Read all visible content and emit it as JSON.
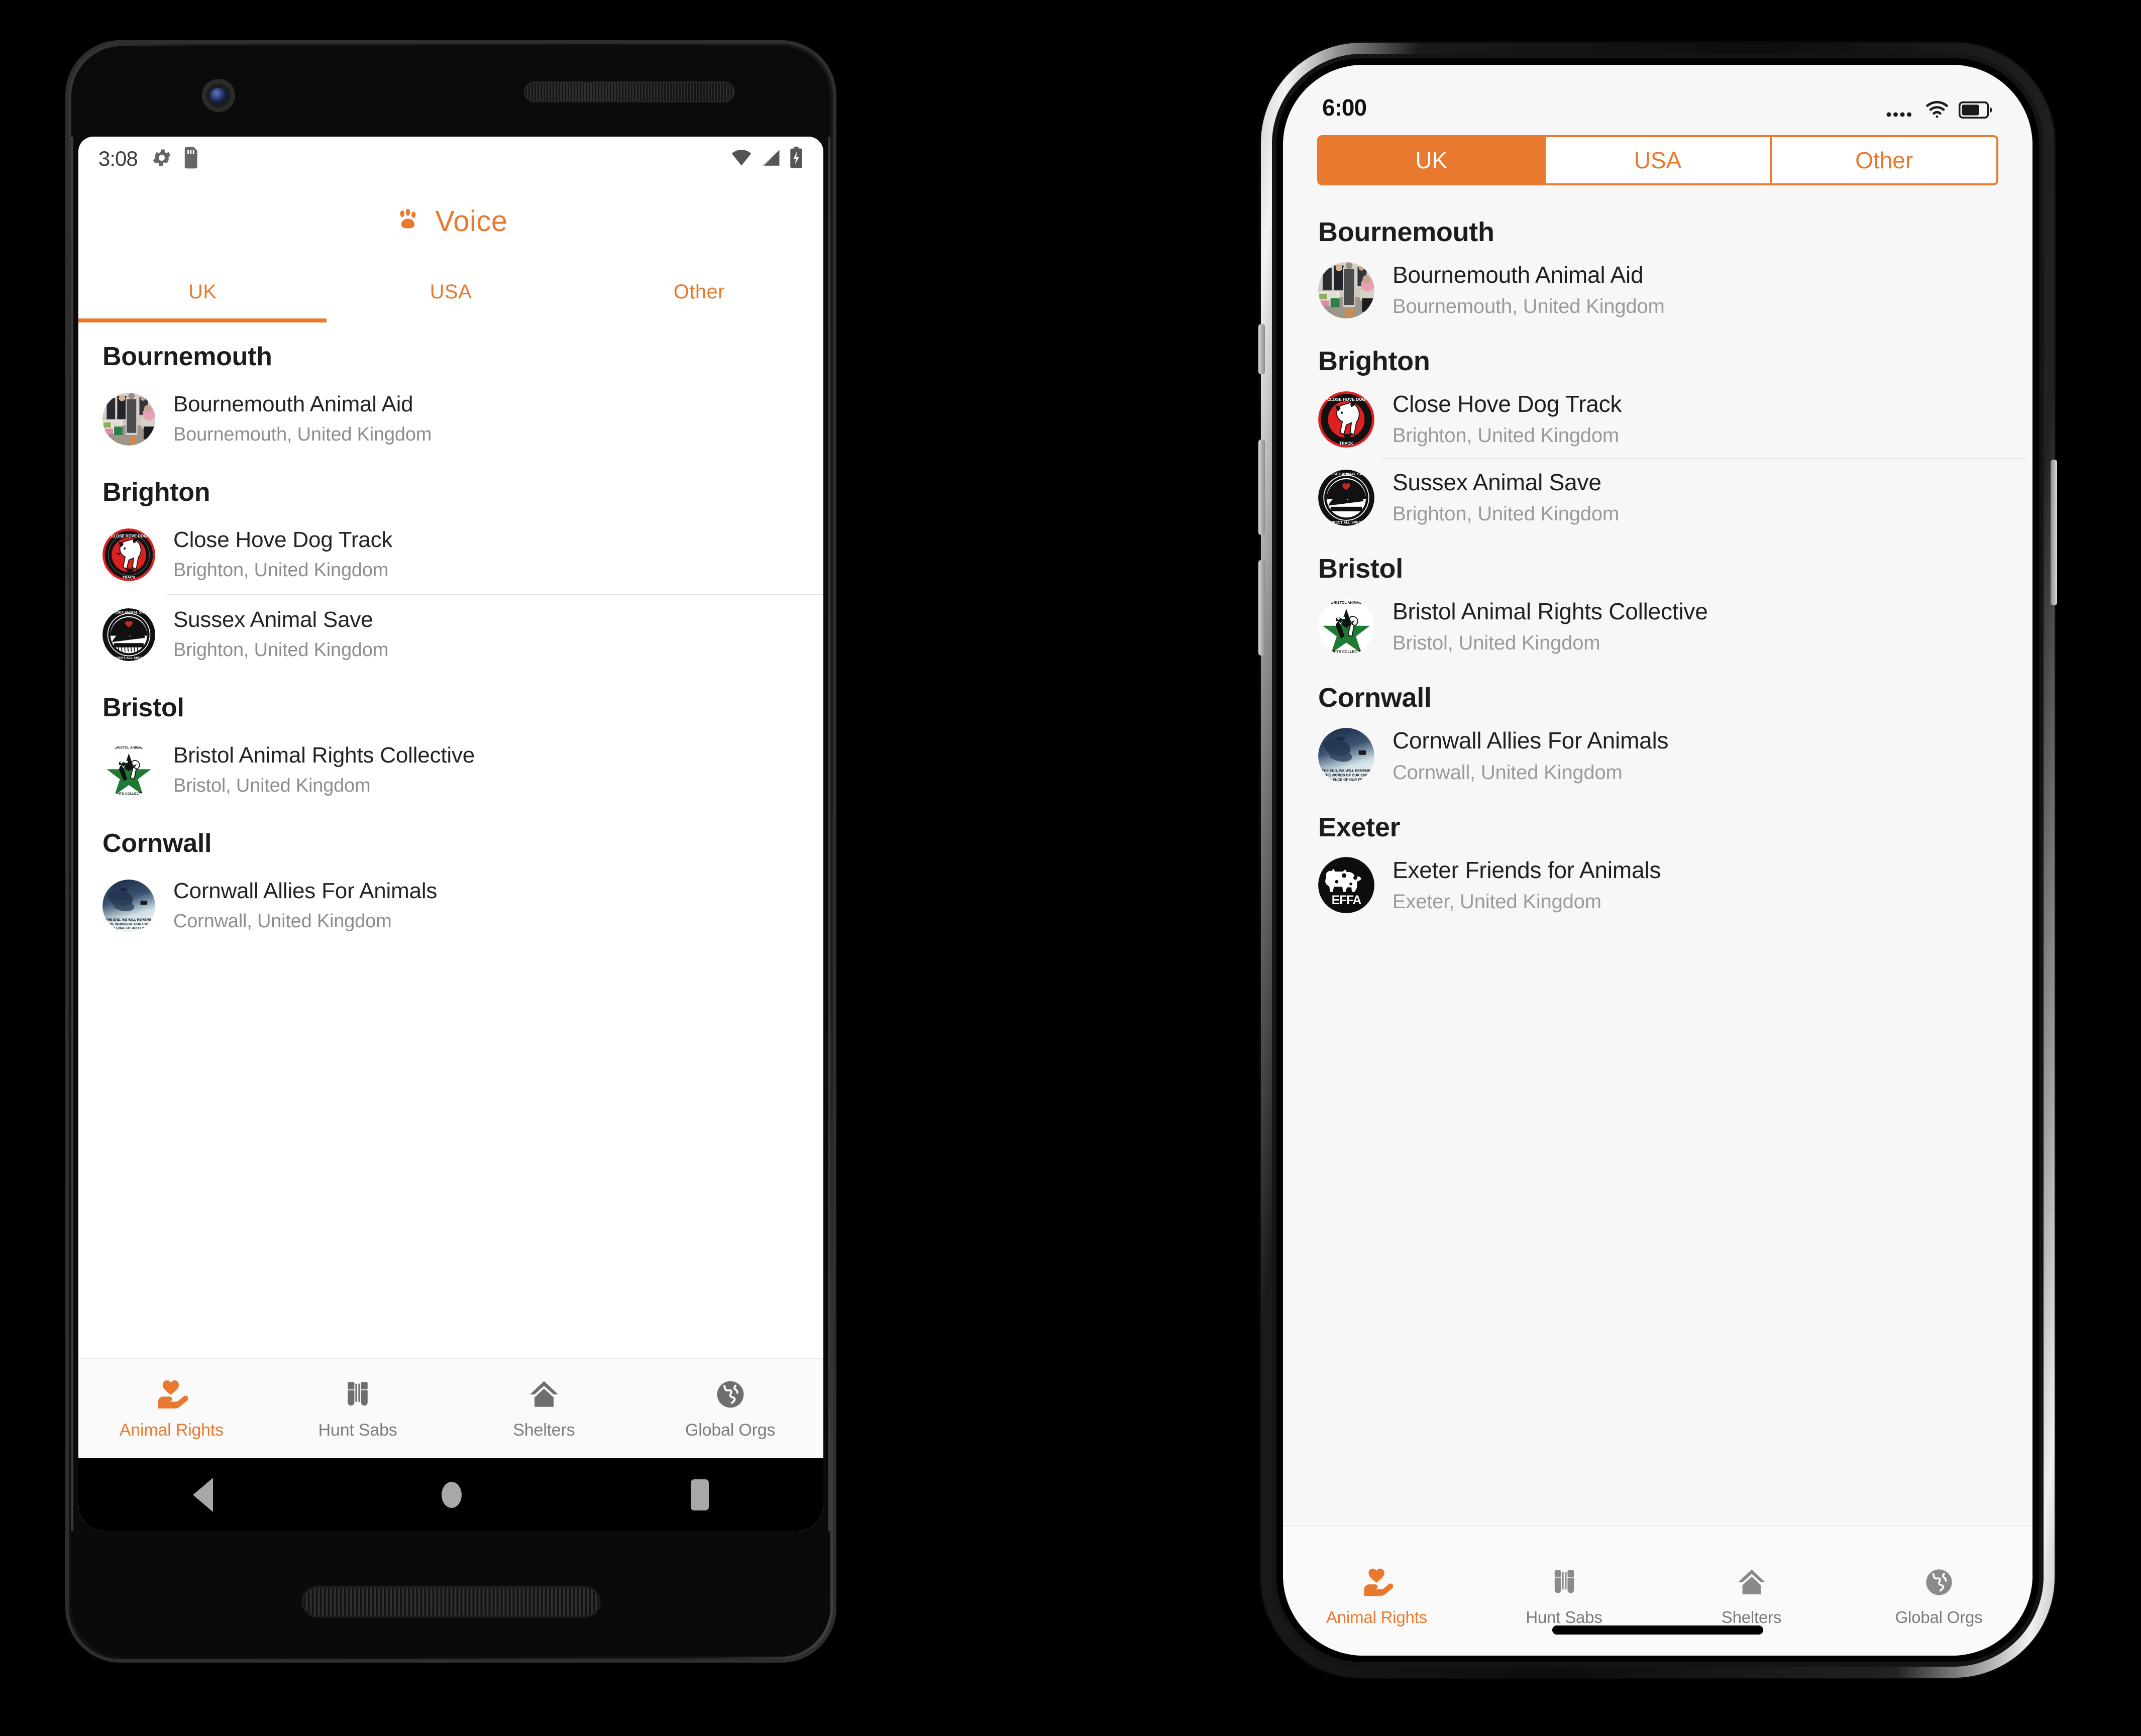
{
  "theme": {
    "accent": "#E8792E",
    "title_color": "#1c1c1c",
    "subtitle_color": "#8d8d8d"
  },
  "android": {
    "status_bar": {
      "time": "3:08",
      "icons": [
        "gear-icon",
        "sd-card-icon",
        "wifi-icon",
        "signal-icon",
        "battery-charging-icon"
      ]
    },
    "app_bar": {
      "title": "Voice",
      "logo": "paw-print-icon"
    },
    "tabs": [
      {
        "label": "UK",
        "active": true
      },
      {
        "label": "USA",
        "active": false
      },
      {
        "label": "Other",
        "active": false
      }
    ],
    "groups": [
      {
        "header": "Bournemouth",
        "items": [
          {
            "title": "Bournemouth Animal Aid",
            "subtitle": "Bournemouth, United Kingdom",
            "avatar": "bournemouth-stall-photo",
            "divider": false
          }
        ]
      },
      {
        "header": "Brighton",
        "items": [
          {
            "title": "Close Hove Dog Track",
            "subtitle": "Brighton, United Kingdom",
            "avatar": "close-hove-dog-track-logo",
            "divider": true
          },
          {
            "title": "Sussex Animal Save",
            "subtitle": "Brighton, United Kingdom",
            "avatar": "sussex-animal-save-logo",
            "divider": false
          }
        ]
      },
      {
        "header": "Bristol",
        "items": [
          {
            "title": "Bristol Animal Rights Collective",
            "subtitle": "Bristol, United Kingdom",
            "avatar": "bristol-animal-rights-collective-logo",
            "divider": false
          }
        ]
      },
      {
        "header": "Cornwall",
        "items": [
          {
            "title": "Cornwall Allies For Animals",
            "subtitle": "Cornwall, United Kingdom",
            "avatar": "cornwall-dolphin-photo",
            "divider": false
          }
        ]
      }
    ],
    "bottom_nav": [
      {
        "label": "Animal Rights",
        "icon": "heart-in-hand-icon",
        "active": true
      },
      {
        "label": "Hunt Sabs",
        "icon": "binoculars-icon",
        "active": false
      },
      {
        "label": "Shelters",
        "icon": "house-icon",
        "active": false
      },
      {
        "label": "Global Orgs",
        "icon": "globe-icon",
        "active": false
      }
    ],
    "system_nav": [
      "back-button",
      "home-button",
      "recents-button"
    ]
  },
  "iphone": {
    "status_bar": {
      "time": "6:00",
      "icons": [
        "cellular-dots-icon",
        "wifi-icon",
        "battery-icon"
      ]
    },
    "segmented_control": [
      {
        "label": "UK",
        "active": true
      },
      {
        "label": "USA",
        "active": false
      },
      {
        "label": "Other",
        "active": false
      }
    ],
    "groups": [
      {
        "header": "Bournemouth",
        "items": [
          {
            "title": "Bournemouth Animal Aid",
            "subtitle": "Bournemouth, United Kingdom",
            "avatar": "bournemouth-stall-photo",
            "divider": false
          }
        ]
      },
      {
        "header": "Brighton",
        "items": [
          {
            "title": "Close Hove Dog Track",
            "subtitle": "Brighton, United Kingdom",
            "avatar": "close-hove-dog-track-logo",
            "divider": true
          },
          {
            "title": "Sussex Animal Save",
            "subtitle": "Brighton, United Kingdom",
            "avatar": "sussex-animal-save-logo",
            "divider": false
          }
        ]
      },
      {
        "header": "Bristol",
        "items": [
          {
            "title": "Bristol Animal Rights Collective",
            "subtitle": "Bristol, United Kingdom",
            "avatar": "bristol-animal-rights-collective-logo",
            "divider": false
          }
        ]
      },
      {
        "header": "Cornwall",
        "items": [
          {
            "title": "Cornwall Allies For Animals",
            "subtitle": "Cornwall, United Kingdom",
            "avatar": "cornwall-dolphin-photo",
            "divider": false
          }
        ]
      },
      {
        "header": "Exeter",
        "items": [
          {
            "title": "Exeter Friends for Animals",
            "subtitle": "Exeter, United Kingdom",
            "avatar": "effa-cows-logo",
            "divider": false
          }
        ]
      }
    ],
    "tab_bar": [
      {
        "label": "Animal Rights",
        "icon": "heart-in-hand-icon",
        "active": true
      },
      {
        "label": "Hunt Sabs",
        "icon": "binoculars-icon",
        "active": false
      },
      {
        "label": "Shelters",
        "icon": "house-icon",
        "active": false
      },
      {
        "label": "Global Orgs",
        "icon": "globe-icon",
        "active": false
      }
    ]
  }
}
